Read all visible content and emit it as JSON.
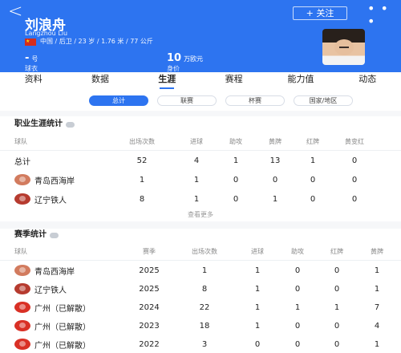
{
  "header": {
    "back": "<",
    "follow": "+ 关注",
    "more": "• • •",
    "name": "刘浪舟",
    "pinyin": "Langzhou Liu",
    "meta": "中国 / 后卫 / 23 岁 / 1.76 米 / 77 公斤",
    "jersey_value": "-",
    "jersey_unit": "号",
    "jersey_label": "球衣",
    "value_value": "10",
    "value_unit": "万欧元",
    "value_label": "身价"
  },
  "tabs": [
    {
      "label": "资料"
    },
    {
      "label": "数据"
    },
    {
      "label": "生涯"
    },
    {
      "label": "赛程"
    },
    {
      "label": "能力值"
    },
    {
      "label": "动态"
    }
  ],
  "active_tab": "生涯",
  "filters": [
    {
      "label": "总计"
    },
    {
      "label": "联赛"
    },
    {
      "label": "杯赛"
    },
    {
      "label": "国家/地区"
    }
  ],
  "career": {
    "title": "职业生涯统计",
    "headers": [
      "球队",
      "出场次数",
      "进球",
      "助攻",
      "黄牌",
      "红牌",
      "黄变红"
    ],
    "total": {
      "label": "总计",
      "values": [
        "52",
        "4",
        "1",
        "13",
        "1",
        "0"
      ]
    },
    "rows": [
      {
        "team": "青岛西海岸",
        "values": [
          "1",
          "1",
          "0",
          "0",
          "0",
          "0"
        ]
      },
      {
        "team": "辽宁铁人",
        "values": [
          "8",
          "1",
          "0",
          "1",
          "0",
          "0"
        ]
      }
    ],
    "see_more": "查看更多"
  },
  "season": {
    "title": "赛季统计",
    "headers": [
      "球队",
      "赛季",
      "出场次数",
      "进球",
      "助攻",
      "红牌",
      "黄牌"
    ],
    "rows": [
      {
        "team": "青岛西海岸",
        "values": [
          "2025",
          "1",
          "1",
          "0",
          "0",
          "1"
        ]
      },
      {
        "team": "辽宁铁人",
        "values": [
          "2025",
          "8",
          "1",
          "0",
          "0",
          "1"
        ]
      },
      {
        "team": "广州（已解散）",
        "values": [
          "2024",
          "22",
          "1",
          "1",
          "1",
          "7"
        ]
      },
      {
        "team": "广州（已解散）",
        "values": [
          "2023",
          "18",
          "1",
          "0",
          "0",
          "4"
        ]
      },
      {
        "team": "广州（已解散）",
        "values": [
          "2022",
          "3",
          "0",
          "0",
          "0",
          "1"
        ]
      }
    ]
  },
  "colors": {
    "brand": "#2d74f0",
    "background": "#f6f7f9"
  }
}
